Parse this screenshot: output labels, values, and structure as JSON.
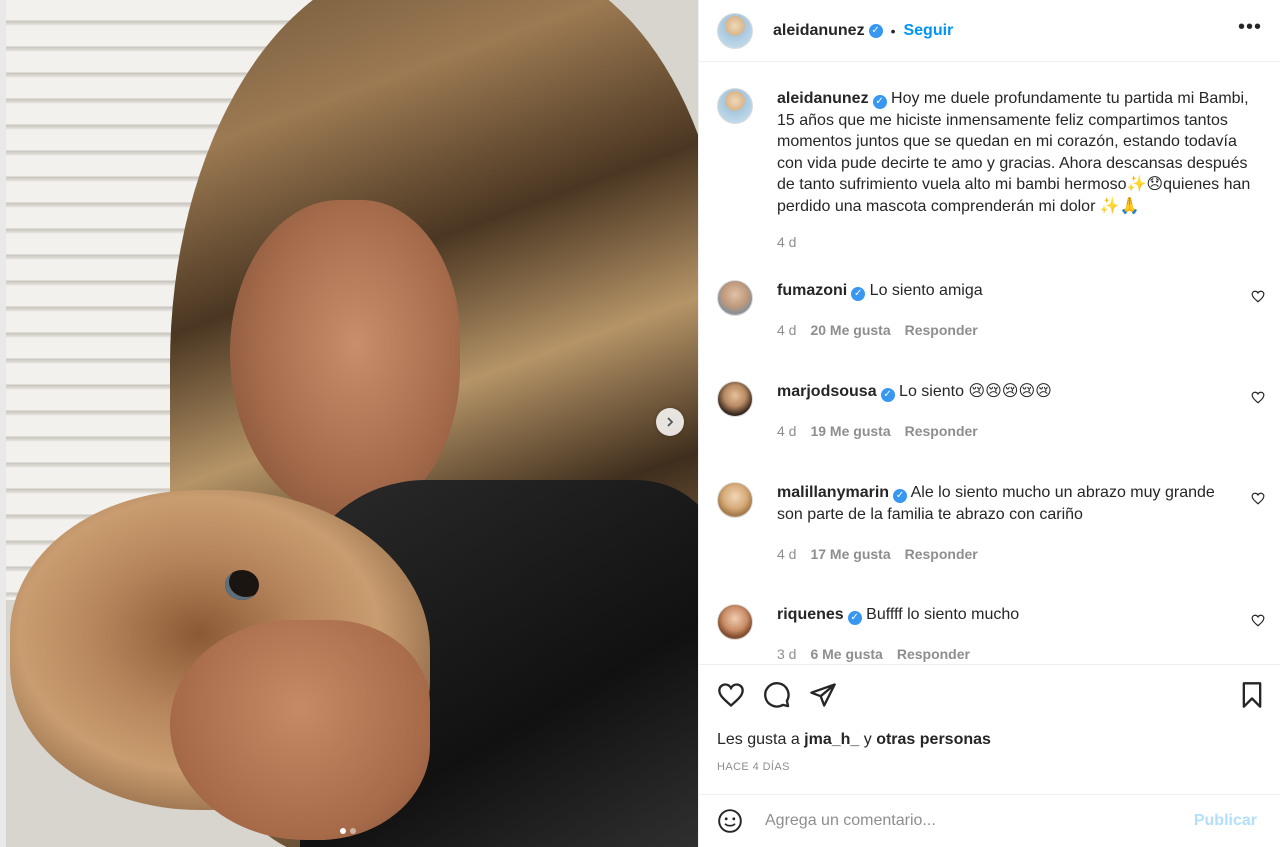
{
  "post": {
    "author": "aleidanunez",
    "follow_label": "Seguir",
    "more_label": "•••",
    "caption": "Hoy me duele profundamente tu partida mi Bambi, 15 años que me hiciste inmensamente feliz compartimos tantos momentos juntos que se quedan en mi corazón, estando todavía con vida pude decirte te amo y gracias. Ahora descansas después de tanto sufrimiento vuela alto mi bambi hermoso✨😞quienes han perdido una mascota comprenderán mi dolor ✨🙏",
    "caption_time": "4 d"
  },
  "comments": [
    {
      "user": "fumazoni",
      "text": "Lo siento amiga",
      "time": "4 d",
      "likes": "20 Me gusta",
      "reply": "Responder"
    },
    {
      "user": "marjodsousa",
      "text": "Lo siento 😢😢😢😢😢",
      "time": "4 d",
      "likes": "19 Me gusta",
      "reply": "Responder"
    },
    {
      "user": "malillanymarin",
      "text": "Ale lo siento mucho un abrazo muy grande son parte de la familia te abrazo con cariño",
      "time": "4 d",
      "likes": "17 Me gusta",
      "reply": "Responder"
    },
    {
      "user": "riquenes",
      "text": "Buffff lo siento mucho",
      "time": "3 d",
      "likes": "6 Me gusta",
      "reply": "Responder"
    }
  ],
  "footer": {
    "likes_prefix": "Les gusta a ",
    "likes_user": "jma_h_",
    "likes_mid": " y ",
    "likes_others": "otras personas",
    "date": "HACE 4 DÍAS",
    "comment_placeholder": "Agrega un comentario...",
    "publish_label": "Publicar"
  },
  "icons": {
    "verified": "verified-badge-icon",
    "heart": "heart-icon",
    "comment": "comment-icon",
    "share": "share-icon",
    "bookmark": "bookmark-icon",
    "emoji": "emoji-icon",
    "next": "chevron-right-icon"
  },
  "colors": {
    "accent": "#0095f6",
    "verified": "#3897f0",
    "publish_disabled": "#b2dffc"
  },
  "carousel": {
    "current": 1,
    "total": 2
  }
}
